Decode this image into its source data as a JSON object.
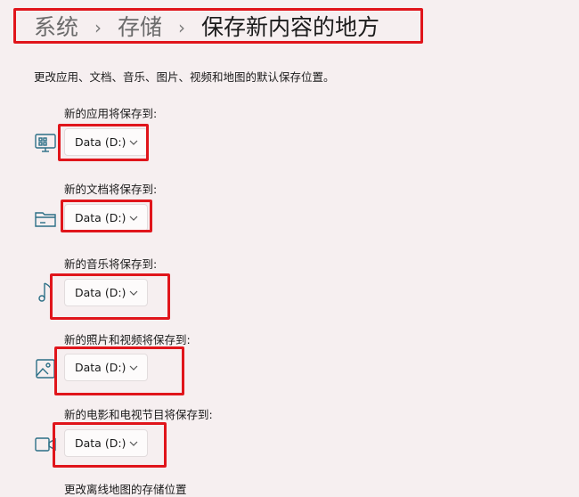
{
  "breadcrumb": {
    "level1": "系统",
    "level2": "存储",
    "current": "保存新内容的地方",
    "separator": "›"
  },
  "description": "更改应用、文档、音乐、图片、视频和地图的默认保存位置。",
  "sections": [
    {
      "label": "新的应用将保存到:",
      "icon": "monitor-icon",
      "value": "Data (D:)"
    },
    {
      "label": "新的文档将保存到:",
      "icon": "folder-icon",
      "value": "Data (D:)"
    },
    {
      "label": "新的音乐将保存到:",
      "icon": "music-note-icon",
      "value": "Data (D:)"
    },
    {
      "label": "新的照片和视频将保存到:",
      "icon": "image-icon",
      "value": "Data (D:)"
    },
    {
      "label": "新的电影和电视节目将保存到:",
      "icon": "video-camera-icon",
      "value": "Data (D:)"
    }
  ],
  "offline_maps_label": "更改离线地图的存储位置",
  "colors": {
    "accent_icon": "#2b6f86",
    "highlight": "#e0151b",
    "background": "#f6eff0"
  }
}
